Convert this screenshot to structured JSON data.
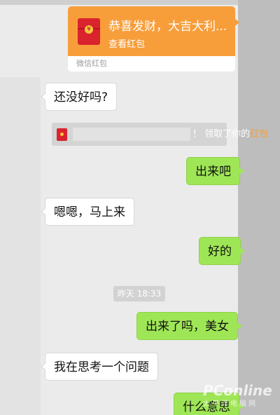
{
  "red_packet": {
    "title": "恭喜发财，大吉大利...",
    "action": "查看红包",
    "footer": "微信红包",
    "icon_symbol": "¥"
  },
  "notice": {
    "text": "！ 领取了你的",
    "link": "红包"
  },
  "messages": [
    {
      "side": "left",
      "text": "还没好吗?"
    },
    {
      "side": "right",
      "text": "出来吧"
    },
    {
      "side": "left",
      "text": "嗯嗯，马上来"
    },
    {
      "side": "right",
      "text": "好的"
    },
    {
      "side": "right",
      "text": "出来了吗，美女"
    },
    {
      "side": "left",
      "text": "我在思考一个问题"
    },
    {
      "side": "right",
      "text": "什么意思"
    }
  ],
  "timestamp": "昨天 18:33",
  "watermark": {
    "main": "PConline",
    "sub": "太平洋电脑网"
  },
  "colors": {
    "orange": "#f79e3b",
    "green_bubble": "#9fe656",
    "red": "#d9232d"
  }
}
